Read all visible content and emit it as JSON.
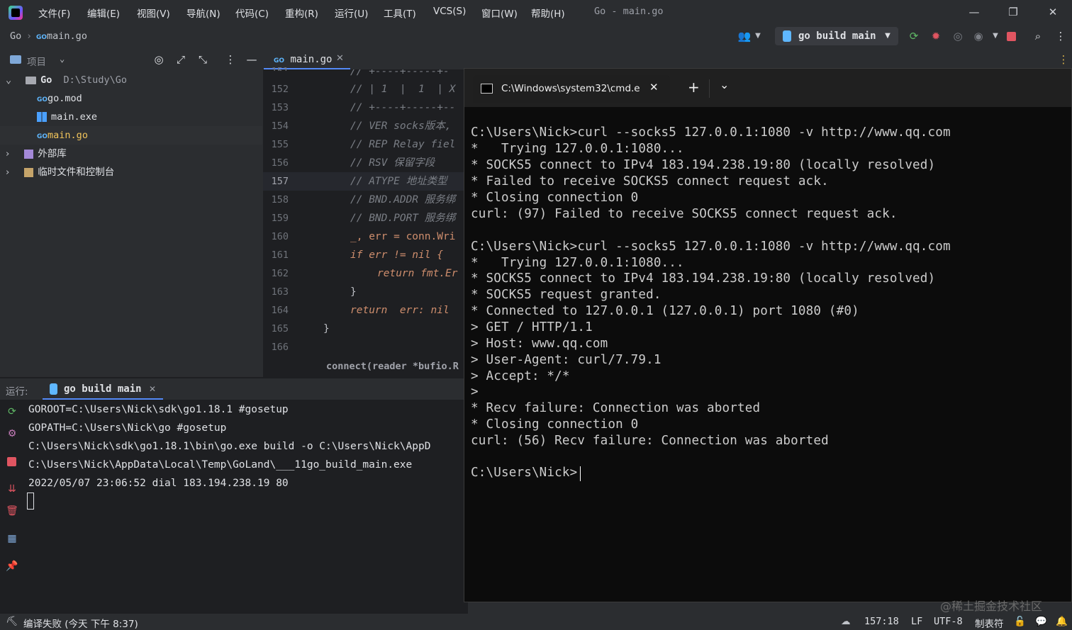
{
  "window": {
    "title": "Go - main.go",
    "menu": [
      "文件(F)",
      "编辑(E)",
      "视图(V)",
      "导航(N)",
      "代码(C)",
      "重构(R)",
      "运行(U)",
      "工具(T)",
      "VCS(S)",
      "窗口(W)",
      "帮助(H)"
    ],
    "controls": {
      "minimize": "—",
      "restore": "❐",
      "close": "✕"
    }
  },
  "breadcrumb": {
    "project": "Go",
    "file": "main.go"
  },
  "toolbar": {
    "run_config": "go build main",
    "icons": [
      "users-icon",
      "rerun-icon",
      "debug-icon",
      "coverage-icon",
      "profile-icon",
      "stop-icon",
      "search-icon",
      "more-icon"
    ]
  },
  "project": {
    "header": "项目",
    "root": {
      "name": "Go",
      "path": "D:\\Study\\Go"
    },
    "files": [
      "go.mod",
      "main.exe",
      "main.go"
    ],
    "external_libs": "外部库",
    "scratches": "临时文件和控制台"
  },
  "editor": {
    "tab": "main.go",
    "current_line": 157,
    "lines": [
      {
        "num": "151",
        "text": "// +----+-----+-"
      },
      {
        "num": "152",
        "text": "// | 1  |  1  | X"
      },
      {
        "num": "153",
        "text": "// +----+-----+--"
      },
      {
        "num": "154",
        "text": "// VER socks版本,"
      },
      {
        "num": "155",
        "text": "// REP Relay fiel"
      },
      {
        "num": "156",
        "text": "// RSV 保留字段"
      },
      {
        "num": "157",
        "text": "// ATYPE 地址类型"
      },
      {
        "num": "158",
        "text": "// BND.ADDR 服务绑"
      },
      {
        "num": "159",
        "text": "// BND.PORT 服务绑"
      },
      {
        "num": "160",
        "text": "_, err = conn.Wri"
      },
      {
        "num": "161",
        "text": "if err != nil {"
      },
      {
        "num": "162",
        "text": "return fmt.Er"
      },
      {
        "num": "163",
        "text": "}"
      },
      {
        "num": "164",
        "text": "return  err: nil"
      },
      {
        "num": "165",
        "text": "}"
      },
      {
        "num": "166",
        "text": ""
      }
    ],
    "footer": "connect(reader *bufio.R"
  },
  "run": {
    "label": "运行:",
    "tab": "go build main",
    "output": [
      "GOROOT=C:\\Users\\Nick\\sdk\\go1.18.1 #gosetup",
      "GOPATH=C:\\Users\\Nick\\go #gosetup",
      "C:\\Users\\Nick\\sdk\\go1.18.1\\bin\\go.exe build -o C:\\Users\\Nick\\AppD",
      "C:\\Users\\Nick\\AppData\\Local\\Temp\\GoLand\\___11go_build_main.exe",
      "2022/05/07 23:06:52 dial 183.194.238.19 80"
    ]
  },
  "terminal": {
    "tab_title": "C:\\Windows\\system32\\cmd.e",
    "new_tab": "+",
    "dropdown": "⌄",
    "lines": [
      "C:\\Users\\Nick>curl --socks5 127.0.0.1:1080 -v http://www.qq.com",
      "*   Trying 127.0.0.1:1080...",
      "* SOCKS5 connect to IPv4 183.194.238.19:80 (locally resolved)",
      "* Failed to receive SOCKS5 connect request ack.",
      "* Closing connection 0",
      "curl: (97) Failed to receive SOCKS5 connect request ack.",
      "",
      "C:\\Users\\Nick>curl --socks5 127.0.0.1:1080 -v http://www.qq.com",
      "*   Trying 127.0.0.1:1080...",
      "* SOCKS5 connect to IPv4 183.194.238.19:80 (locally resolved)",
      "* SOCKS5 request granted.",
      "* Connected to 127.0.0.1 (127.0.0.1) port 1080 (#0)",
      "> GET / HTTP/1.1",
      "> Host: www.qq.com",
      "> User-Agent: curl/7.79.1",
      "> Accept: */*",
      ">",
      "* Recv failure: Connection was aborted",
      "* Closing connection 0",
      "curl: (56) Recv failure: Connection was aborted",
      "",
      "C:\\Users\\Nick>"
    ]
  },
  "status": {
    "message": "编译失败 (今天 下午 8:37)",
    "position": "157:18",
    "line_sep": "LF",
    "encoding": "UTF-8",
    "indent": "制表符"
  },
  "watermark": "@稀土掘金技术社区"
}
